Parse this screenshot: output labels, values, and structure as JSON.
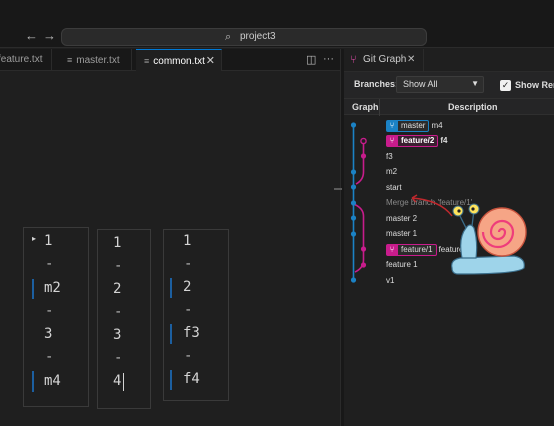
{
  "titlebar": {
    "back_icon": "arrow-left-icon",
    "forward_icon": "arrow-right-icon",
    "search_icon": "search-icon",
    "search_text": "project3"
  },
  "editor_tabs": [
    {
      "label": "feature.txt",
      "active": false
    },
    {
      "label": "master.txt",
      "active": false
    },
    {
      "label": "common.txt",
      "active": true,
      "close": "✕"
    }
  ],
  "editor_toolbar": {
    "split_icon": "split-editor-icon",
    "more_icon": "more-actions-icon",
    "more": "···"
  },
  "compare_columns": [
    {
      "lines": [
        "1",
        "-",
        "m2",
        "-",
        "3",
        "-",
        "m4"
      ]
    },
    {
      "lines": [
        "1",
        "-",
        "2",
        "-",
        "3",
        "-",
        "4"
      ]
    },
    {
      "lines": [
        "1",
        "-",
        "2",
        "-",
        "f3",
        "-",
        "f4"
      ]
    }
  ],
  "git_graph": {
    "tab_label": "Git Graph",
    "tab_close": "✕",
    "branches_label": "Branches:",
    "branches_value": "Show All",
    "show_remote_label": "Show Rem",
    "show_remote_checked": true,
    "col_graph": "Graph",
    "col_description": "Description",
    "commits": [
      {
        "refs": [
          {
            "name": "master",
            "style": "blue"
          }
        ],
        "message": "m4"
      },
      {
        "refs": [
          {
            "name": "feature/2",
            "style": "pink"
          }
        ],
        "message": "f4"
      },
      {
        "refs": [],
        "message": "f3"
      },
      {
        "refs": [],
        "message": "m2"
      },
      {
        "refs": [],
        "message": "start"
      },
      {
        "refs": [],
        "message": "Merge branch 'feature/1'",
        "dim": true
      },
      {
        "refs": [],
        "message": "master 2"
      },
      {
        "refs": [],
        "message": "master 1"
      },
      {
        "refs": [
          {
            "name": "feature/1",
            "style": "pinkdim"
          }
        ],
        "message": "feature 2"
      },
      {
        "refs": [],
        "message": "feature 1"
      },
      {
        "refs": [],
        "message": "v1"
      }
    ]
  },
  "colors": {
    "accent": "#0078d4",
    "graph_blue": "#1b82c5",
    "graph_pink": "#c81c8c"
  }
}
